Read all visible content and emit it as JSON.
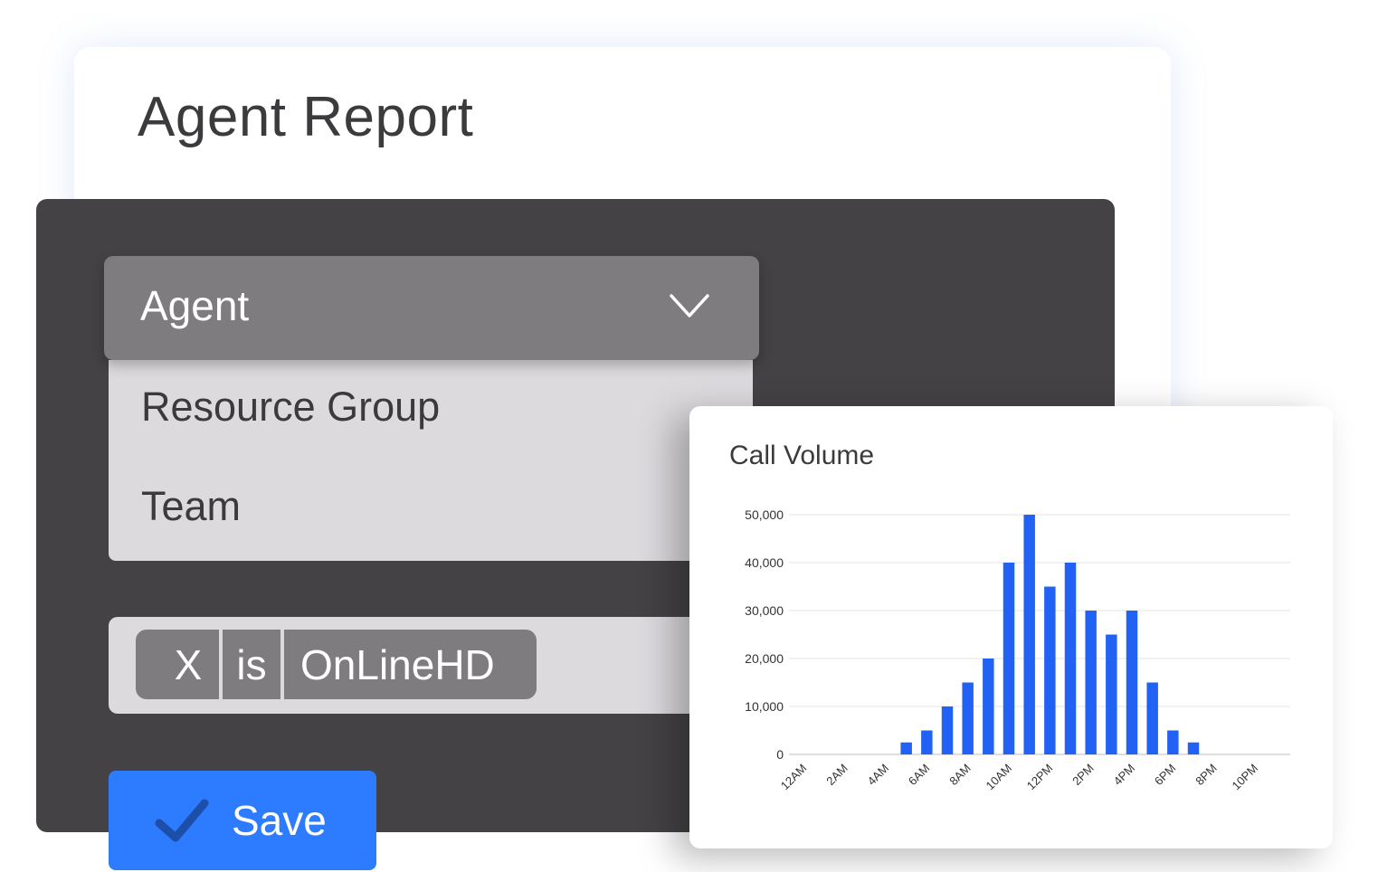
{
  "report": {
    "title": "Agent Report"
  },
  "dropdown": {
    "selected": "Agent",
    "options": [
      "Resource Group",
      "Team"
    ]
  },
  "filter": {
    "remove": "X",
    "operator": "is",
    "value": "OnLineHD"
  },
  "save": {
    "label": "Save"
  },
  "icons": {
    "dropdown": "chevron-down-icon",
    "save": "checkmark-icon"
  },
  "colors": {
    "accent": "#2d7bff",
    "bar": "#2162f5",
    "panel": "#444245"
  },
  "chart_data": {
    "type": "bar",
    "title": "Call Volume",
    "xlabel": "",
    "ylabel": "",
    "x_tick_labels": [
      "12AM",
      "2AM",
      "4AM",
      "6AM",
      "8AM",
      "10AM",
      "12PM",
      "2PM",
      "4PM",
      "6PM",
      "8PM",
      "10PM"
    ],
    "y_ticks": [
      "0",
      "10,000",
      "20,000",
      "30,000",
      "40,000",
      "50,000"
    ],
    "ylim": [
      0,
      50000
    ],
    "grid": true,
    "categories": [
      "12AM",
      "1AM",
      "2AM",
      "3AM",
      "4AM",
      "5AM",
      "6AM",
      "7AM",
      "8AM",
      "9AM",
      "10AM",
      "11AM",
      "12PM",
      "1PM",
      "2PM",
      "3PM",
      "4PM",
      "5PM",
      "6PM",
      "7PM",
      "8PM",
      "9PM",
      "10PM",
      "11PM"
    ],
    "values": [
      0,
      0,
      0,
      0,
      0,
      2500,
      5000,
      10000,
      15000,
      20000,
      40000,
      50000,
      35000,
      40000,
      30000,
      25000,
      30000,
      15000,
      5000,
      2500,
      0,
      0,
      0,
      0
    ]
  }
}
